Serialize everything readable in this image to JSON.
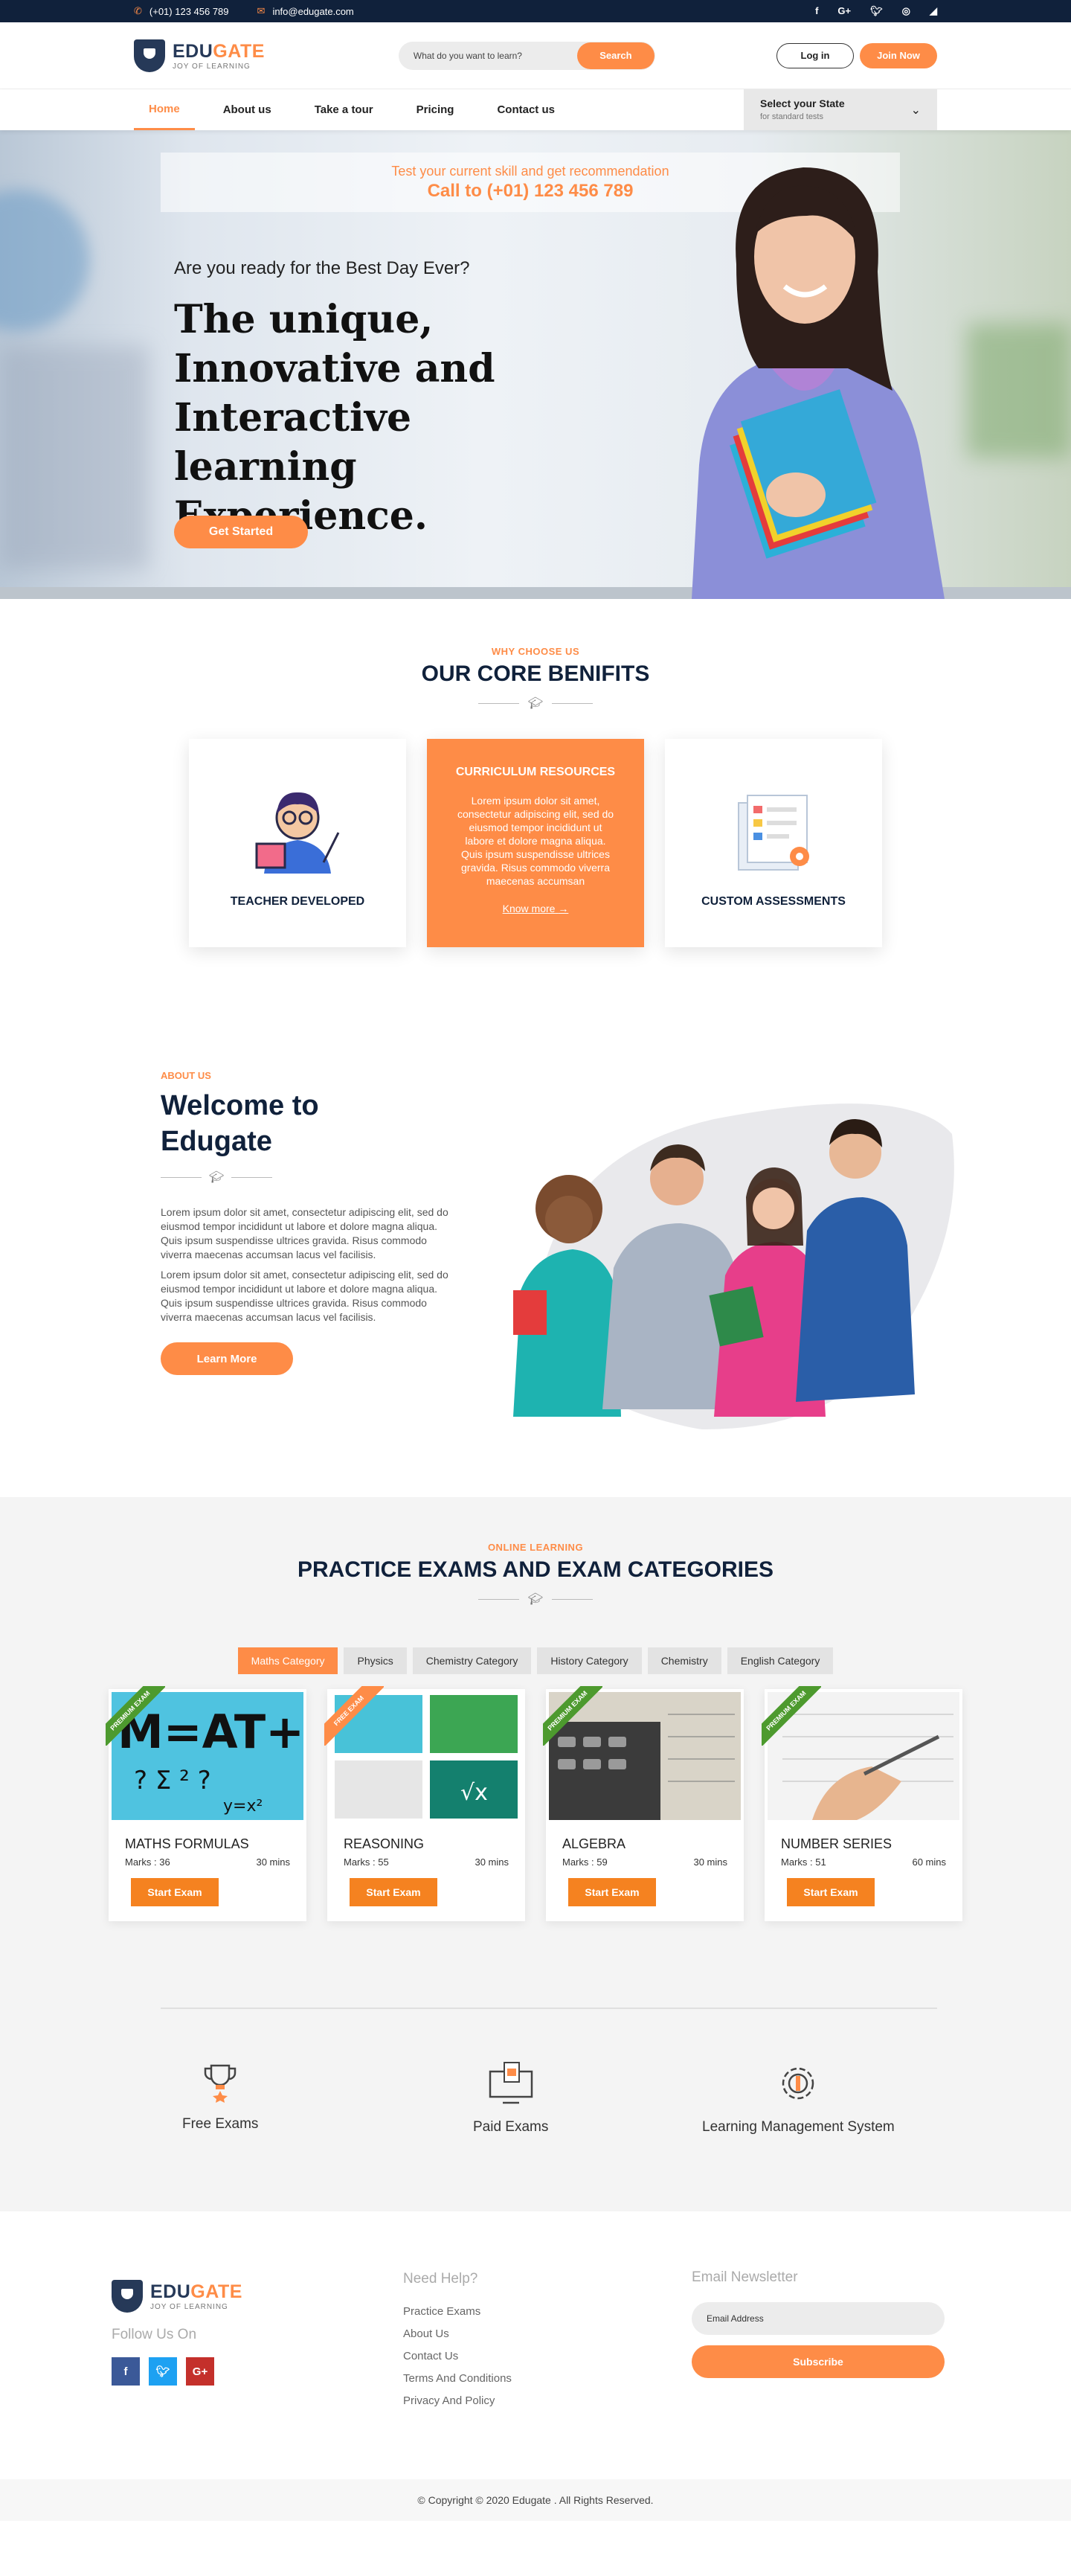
{
  "topbar": {
    "phone": "(+01) 123 456 789",
    "email": "info@edugate.com",
    "social": [
      "f",
      "G+",
      "t",
      "in",
      "rss"
    ]
  },
  "brand": {
    "name_a": "EDU",
    "name_b": "GATE",
    "tagline": "JOY OF LEARNING"
  },
  "search": {
    "placeholder": "What do you want to learn?",
    "button": "Search"
  },
  "header": {
    "login": "Log in",
    "join": "Join Now"
  },
  "nav": {
    "items": [
      "Home",
      "About us",
      "Take a tour",
      "Pricing",
      "Contact us"
    ],
    "active": "Home",
    "state_title": "Select your State",
    "state_sub": "for standard tests"
  },
  "hero": {
    "call_line1": "Test your current skill and get recommendation",
    "call_line2": "Call to  (+01) 123 456 789",
    "pre": "Are you ready for the Best Day Ever?",
    "headline": "The unique, Innovative and Interactive learning Experience.",
    "cta": "Get Started"
  },
  "benefits": {
    "tag": "WHY CHOOSE US",
    "title": "OUR CORE BENIFITS",
    "cards": [
      {
        "title": "TEACHER DEVELOPED"
      },
      {
        "title": "CURRICULUM RESOURCES",
        "text": "Lorem ipsum dolor sit amet, consectetur adipiscing elit, sed do eiusmod tempor incididunt ut labore et dolore magna aliqua. Quis ipsum suspendisse ultrices gravida. Risus commodo viverra maecenas accumsan",
        "link": "Know more"
      },
      {
        "title": "CUSTOM ASSESSMENTS"
      }
    ]
  },
  "about": {
    "tag": "ABOUT US",
    "title": "Welcome to Edugate",
    "p1": "Lorem ipsum dolor sit amet, consectetur adipiscing elit, sed do eiusmod tempor incididunt ut labore et dolore magna aliqua. Quis ipsum suspendisse ultrices gravida. Risus commodo viverra maecenas accumsan lacus vel facilisis.",
    "p2": "Lorem ipsum dolor sit amet, consectetur adipiscing elit, sed do eiusmod tempor incididunt ut labore et dolore magna aliqua. Quis ipsum suspendisse ultrices gravida. Risus commodo viverra maecenas accumsan lacus vel facilisis.",
    "button": "Learn More"
  },
  "practice": {
    "tag": "ONLINE LEARNING",
    "title": "PRACTICE EXAMS AND EXAM CATEGORIES",
    "tabs": [
      "Maths Category",
      "Physics",
      "Chemistry Category",
      "History Category",
      "Chemistry",
      "English Category"
    ],
    "active_tab": "Maths Category",
    "exams": [
      {
        "title": "MATHS FORMULAS",
        "marks": "Marks : 36",
        "time": "30 mins",
        "ribbon": "PREMIUM EXAM",
        "button": "Start Exam"
      },
      {
        "title": "REASONING",
        "marks": "Marks : 55",
        "time": "30 mins",
        "ribbon": "FREE EXAM",
        "button": "Start Exam"
      },
      {
        "title": "ALGEBRA",
        "marks": "Marks : 59",
        "time": "30 mins",
        "ribbon": "PREMIUM EXAM",
        "button": "Start Exam"
      },
      {
        "title": "NUMBER SERIES",
        "marks": "Marks : 51",
        "time": "60 mins",
        "ribbon": "PREMIUM EXAM",
        "button": "Start Exam"
      }
    ],
    "features": [
      "Free Exams",
      "Paid Exams",
      "Learning Management System"
    ]
  },
  "footer": {
    "follow": "Follow Us On",
    "help_title": "Need Help?",
    "links": [
      "Practice Exams",
      "About Us",
      "Contact Us",
      "Terms And Conditions",
      "Privacy And Policy"
    ],
    "news_title": "Email Newsletter",
    "email_placeholder": "Email Address",
    "subscribe": "Subscribe",
    "copyright": "© Copyright © 2020 Edugate . All Rights Reserved."
  },
  "colors": {
    "accent": "#fe8c47",
    "navy": "#10213b",
    "ribbon_green": "#4d9a2e"
  }
}
